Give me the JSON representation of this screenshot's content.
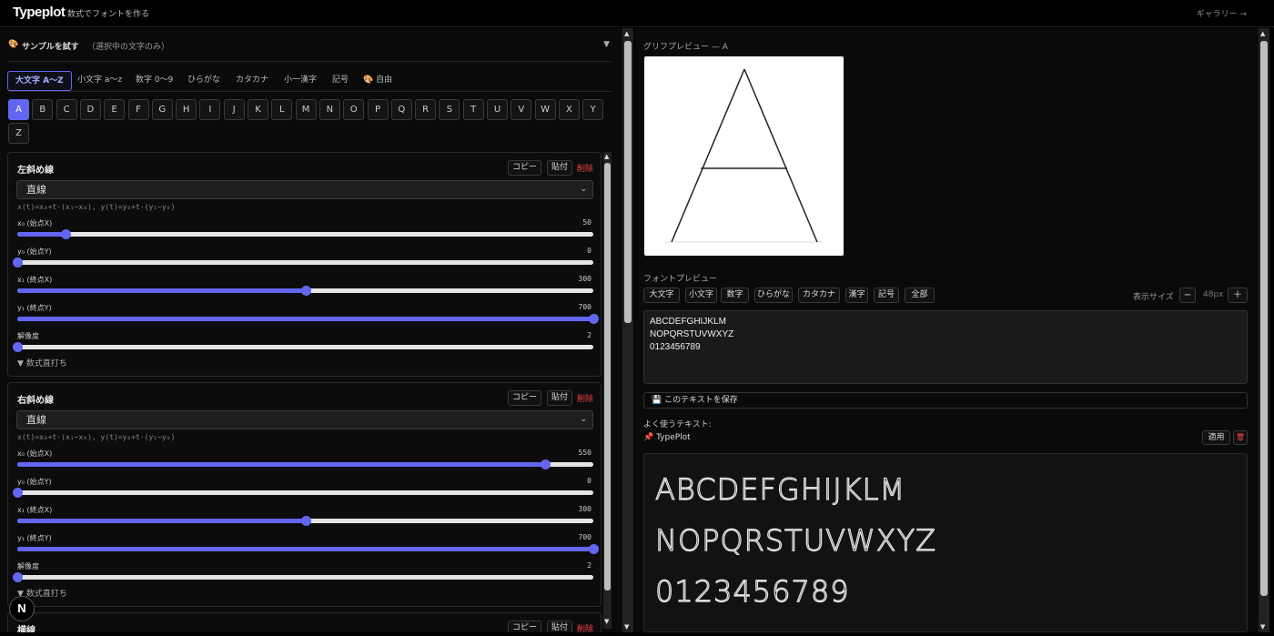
{
  "header": {
    "logo": "Typeplot",
    "tagline": "数式でフォントを作る",
    "gallery_link": "ギャラリー →"
  },
  "sample": {
    "icon": "palette-icon",
    "title": "サンプルを試す",
    "note": "（選択中の文字のみ）",
    "toggle": "▼"
  },
  "categories": [
    {
      "label": "大文字 A〜Z",
      "active": true
    },
    {
      "label": "小文字 a〜z"
    },
    {
      "label": "数字 0〜9"
    },
    {
      "label": "ひらがな"
    },
    {
      "label": "カタカナ"
    },
    {
      "label": "小一漢字"
    },
    {
      "label": "記号"
    },
    {
      "label": "🎨 自由"
    }
  ],
  "letters": [
    "A",
    "B",
    "C",
    "D",
    "E",
    "F",
    "G",
    "H",
    "I",
    "J",
    "K",
    "L",
    "M",
    "N",
    "O",
    "P",
    "Q",
    "R",
    "S",
    "T",
    "U",
    "V",
    "W",
    "X",
    "Y",
    "Z"
  ],
  "selected_letter": "A",
  "card_buttons": {
    "copy": "コピー",
    "paste": "貼付",
    "delete": "削除"
  },
  "strokes": [
    {
      "name": "左斜め線",
      "type": "直線",
      "formula": "x(t)=x₀+t·(x₁−x₀), y(t)=y₀+t·(y₁−y₀)",
      "params": [
        {
          "label": "x₀ (始点X)",
          "value": "50",
          "fraction": 0.083
        },
        {
          "label": "y₀ (始点Y)",
          "value": "0",
          "fraction": 0.0
        },
        {
          "label": "x₁ (終点X)",
          "value": "300",
          "fraction": 0.5
        },
        {
          "label": "y₁ (終点Y)",
          "value": "700",
          "fraction": 1.0
        },
        {
          "label": "解像度",
          "value": "2",
          "fraction": 0.0
        }
      ],
      "direct": "▼ 数式直打ち"
    },
    {
      "name": "右斜め線",
      "type": "直線",
      "formula": "x(t)=x₀+t·(x₁−x₀), y(t)=y₀+t·(y₁−y₀)",
      "params": [
        {
          "label": "x₀ (始点X)",
          "value": "550",
          "fraction": 0.917
        },
        {
          "label": "y₀ (始点Y)",
          "value": "0",
          "fraction": 0.0
        },
        {
          "label": "x₁ (終点X)",
          "value": "300",
          "fraction": 0.5
        },
        {
          "label": "y₁ (終点Y)",
          "value": "700",
          "fraction": 1.0
        },
        {
          "label": "解像度",
          "value": "2",
          "fraction": 0.0
        }
      ],
      "direct": "▼ 数式直打ち"
    },
    {
      "name": "横線"
    }
  ],
  "glyph_preview": {
    "title": "グリフプレビュー — A"
  },
  "font_preview": {
    "title": "フォントプレビュー",
    "tabs": [
      "大文字",
      "小文字",
      "数字",
      "ひらがな",
      "カタカナ",
      "漢字",
      "記号",
      "全部"
    ],
    "size_label": "表示サイズ",
    "size_minus": "−",
    "size_value": "48px",
    "size_plus": "＋",
    "text_lines": [
      "ABCDEFGHIJKLM",
      "NOPQRSTUVWXYZ",
      "0123456789"
    ],
    "save_label": "💾 このテキストを保存",
    "favorites_title": "よく使うテキスト:",
    "favorite_item": "📌 TypePlot",
    "apply_label": "適用",
    "delete_icon": "🗑",
    "render_lines": [
      "ABCDEFGHIJKLM",
      "NOPQRSTUVWXYZ",
      "0123456789"
    ]
  },
  "next_badge": "N",
  "colors": {
    "accent": "#6366f1",
    "danger": "#ef4444"
  }
}
